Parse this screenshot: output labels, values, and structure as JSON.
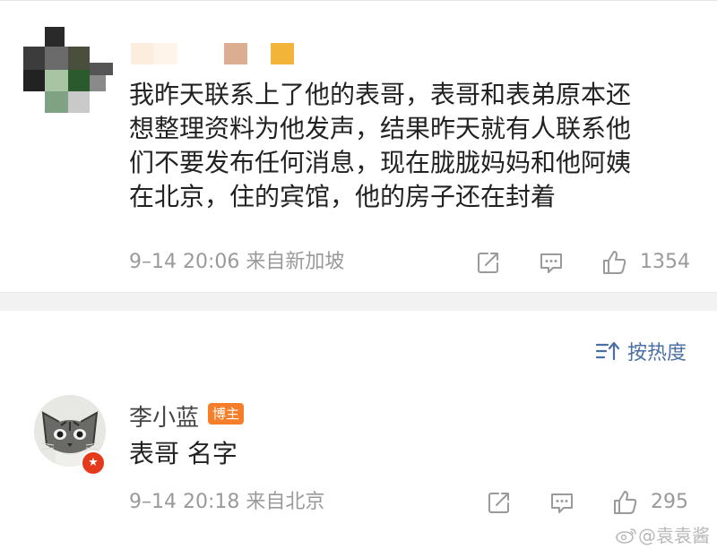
{
  "comment": {
    "lines": [
      "我昨天联系上了他的表哥，表哥和表弟原本还",
      "想整理资料为他发声，结果昨天就有人联系他",
      "们不要发布任何消息，现在胧胧妈妈和他阿姨",
      "在北京，住的宾馆，他的房子还在封着"
    ],
    "meta": "9–14 20:06 来自新加坡",
    "like_count": "1354"
  },
  "sort": {
    "label": "按热度"
  },
  "reply": {
    "author": "李小蓝",
    "badge": "博主",
    "text": "表哥 名字",
    "meta": "9–14 20:18 来自北京",
    "like_count": "295"
  },
  "watermark": {
    "text": "@袁袁酱"
  },
  "colors": {
    "text": "#222222",
    "meta": "#9a9a9a",
    "link": "#4a6fa5",
    "badge": "#f77e29",
    "verified": "#e5391b",
    "separator": "#f2f2f2"
  }
}
